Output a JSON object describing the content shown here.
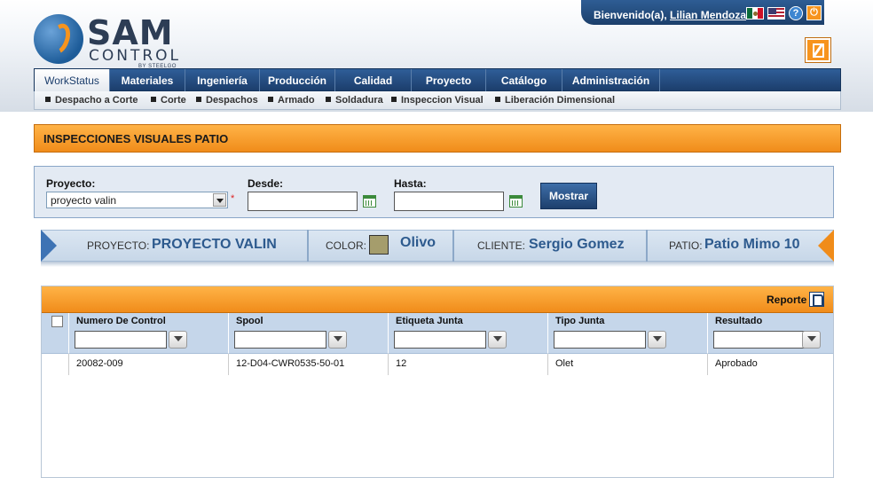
{
  "header": {
    "logo": {
      "title": "SAM",
      "subtitle": "CONTROL",
      "byline": "BY STEELGO"
    },
    "user": {
      "greeting": "Bienvenido(a),",
      "name": "Lilian Mendoza"
    }
  },
  "nav": {
    "tabs": [
      {
        "label": "WorkStatus",
        "active": true
      },
      {
        "label": "Materiales"
      },
      {
        "label": "Ingeniería"
      },
      {
        "label": "Producción"
      },
      {
        "label": "Calidad"
      },
      {
        "label": "Proyecto"
      },
      {
        "label": "Catálogo"
      },
      {
        "label": "Administración"
      }
    ],
    "subtabs": [
      "Despacho a Corte",
      "Corte",
      "Despachos",
      "Armado",
      "Soldadura",
      "Inspeccion Visual",
      "Liberación Dimensional"
    ]
  },
  "page": {
    "title": "INSPECCIONES VISUALES PATIO"
  },
  "filters": {
    "proyecto_label": "Proyecto:",
    "proyecto_value": "proyecto valin",
    "required_mark": "*",
    "desde_label": "Desde:",
    "desde_value": "",
    "hasta_label": "Hasta:",
    "hasta_value": "",
    "mostrar_label": "Mostrar"
  },
  "info": {
    "proyecto_label": "PROYECTO:",
    "proyecto_value": "PROYECTO VALIN",
    "color_label": "COLOR:",
    "color_value": "Olivo",
    "color_hex": "#a59d6c",
    "cliente_label": "CLIENTE:",
    "cliente_value": "Sergio Gomez",
    "patio_label": "PATIO:",
    "patio_value": "Patio Mimo 10"
  },
  "grid": {
    "report_label": "Reporte",
    "columns": [
      "Numero De Control",
      "Spool",
      "Etiqueta Junta",
      "Tipo Junta",
      "Resultado"
    ],
    "rows": [
      [
        "20082-009",
        "12-D04-CWR0535-50-01",
        "12",
        "Olet",
        "Aprobado"
      ]
    ]
  },
  "colors": {
    "accent_orange": "#f08c1a",
    "nav_blue": "#1c3e6c"
  }
}
